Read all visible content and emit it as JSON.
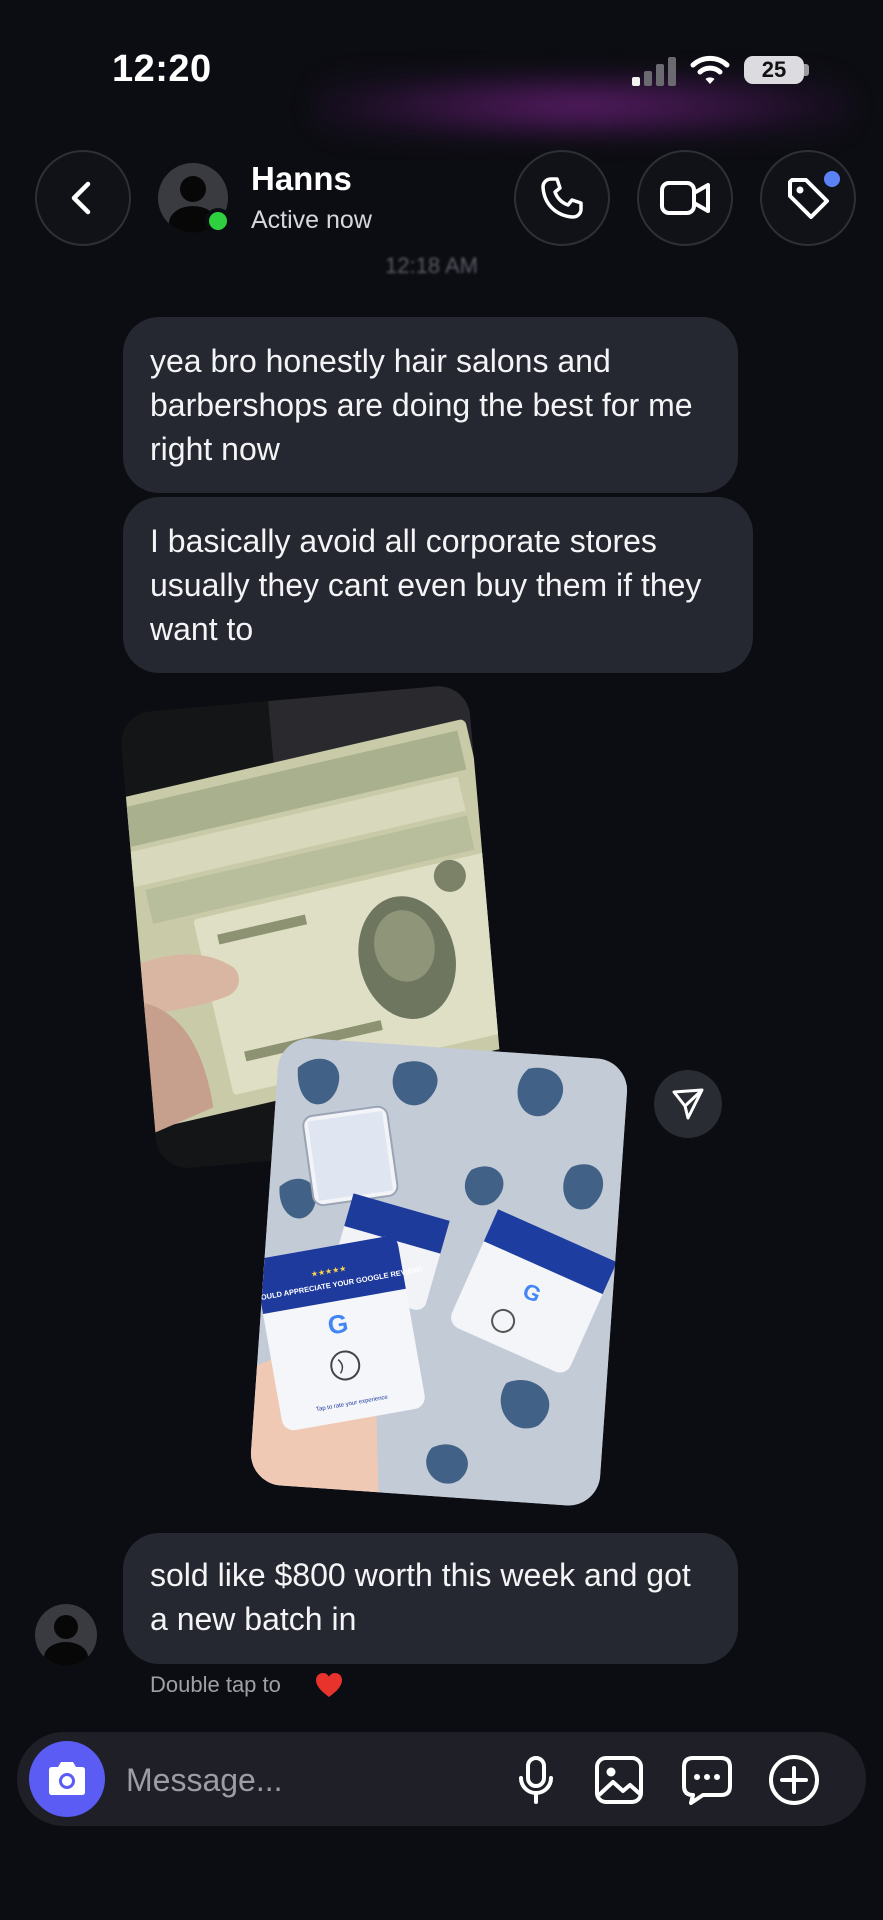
{
  "status_bar": {
    "time": "12:20",
    "battery": "25"
  },
  "header": {
    "contact_name": "Hanns",
    "contact_status": "Active now",
    "timestamp": "12:18 AM"
  },
  "messages": [
    {
      "text": "yea bro honestly hair salons and barbershops are doing the best for me right now"
    },
    {
      "text": "I basically avoid all corporate stores usually they cant even buy them if they want to"
    },
    {
      "text": "sold like $800 worth this week and got a new batch in"
    }
  ],
  "photos": {
    "card_text_1": "WE WOULD APPRECIATE YOUR GOOGLE REVIEW!",
    "card_text_2": "Tap to rate your experience",
    "card_letter": "G"
  },
  "reaction_hint": "Double tap to",
  "composer": {
    "placeholder": "Message..."
  },
  "icons": {
    "back": "chevron-left-icon",
    "call": "phone-icon",
    "video": "video-camera-icon",
    "tag": "tag-icon",
    "share": "send-icon",
    "camera": "camera-icon",
    "mic": "microphone-icon",
    "gallery": "image-icon",
    "sticker": "chat-bubble-icon",
    "add": "plus-circle-icon",
    "heart": "heart-icon"
  },
  "colors": {
    "background": "#0c0d12",
    "bubble": "#262831",
    "online": "#2fd03f",
    "accent": "#5a5cf4",
    "heart": "#e8322c"
  }
}
